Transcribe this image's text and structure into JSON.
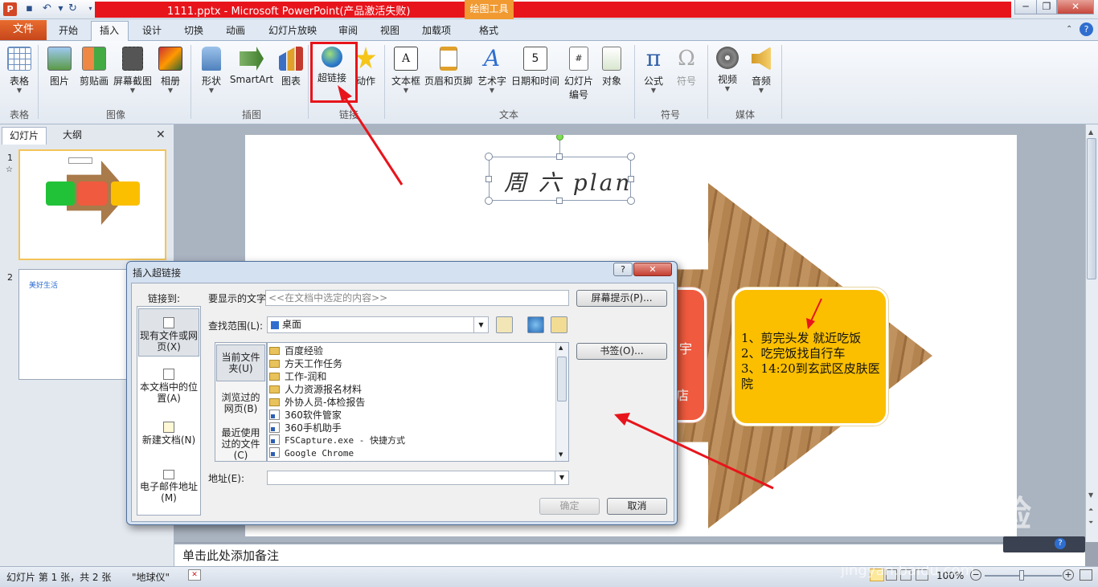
{
  "window": {
    "title": "1111.pptx - Microsoft PowerPoint(产品激活失败)",
    "tools_badge": "绘图工具"
  },
  "tabs": [
    "文件",
    "开始",
    "插入",
    "设计",
    "切换",
    "动画",
    "幻灯片放映",
    "审阅",
    "视图",
    "加载项",
    "格式"
  ],
  "ribbon": {
    "groups": {
      "table": "表格",
      "images": "图像",
      "illustrations": "插图",
      "links": "链接",
      "text": "文本",
      "symbols": "符号",
      "media": "媒体"
    },
    "buttons": {
      "table": "表格",
      "picture": "图片",
      "clipart": "剪贴画",
      "screenshot": "屏幕截图",
      "album": "相册",
      "shapes": "形状",
      "smartart": "SmartArt",
      "chart": "图表",
      "hyperlink": "超链接",
      "action": "动作",
      "textbox": "文本框",
      "header_footer": "页眉和页脚",
      "wordart": "艺术字",
      "datetime": "日期和时间",
      "slide_number_1": "幻灯片",
      "slide_number_2": "编号",
      "object": "对象",
      "equation": "公式",
      "symbol": "符号",
      "video": "视频",
      "audio": "音频"
    }
  },
  "left_pane": {
    "tab_slides": "幻灯片",
    "tab_outline": "大纲",
    "slide1_number": "1",
    "slide2_number": "2",
    "slide1_star": "☆",
    "slide2_title": "美好生活"
  },
  "slide": {
    "title_handwriting": "周 六 plan",
    "box_partial_1": "宇",
    "box_partial_2": "店",
    "yellow_lines": [
      "1、剪完头发 就近吃饭",
      "2、吃完饭找自行车",
      "3、14:20到玄武区皮肤医院"
    ]
  },
  "notes_placeholder": "单击此处添加备注",
  "status": {
    "slide_info": "幻灯片 第 1 张，共 2 张",
    "theme": "\"地球仪\"",
    "zoom": "100%"
  },
  "dialog": {
    "title": "插入超链接",
    "help": "?",
    "close": "✕",
    "link_to_label": "链接到:",
    "nav": [
      "现有文件或网页(X)",
      "本文档中的位置(A)",
      "新建文档(N)",
      "电子邮件地址(M)"
    ],
    "text_to_display_label": "要显示的文字(T):",
    "text_to_display_value": "<<在文档中选定的内容>>",
    "screentip_button": "屏幕提示(P)...",
    "look_in_label": "查找范围(L):",
    "look_in_value": "桌面",
    "sub_nav": [
      "当前文件夹(U)",
      "浏览过的网页(B)",
      "最近使用过的文件(C)"
    ],
    "bookmark_button": "书签(O)...",
    "files": [
      {
        "name": "百度经验",
        "kind": "folder"
      },
      {
        "name": "方天工作任务",
        "kind": "folder"
      },
      {
        "name": "工作-润和",
        "kind": "folder"
      },
      {
        "name": "人力资源报名材料",
        "kind": "folder"
      },
      {
        "name": "外协人员-体检报告",
        "kind": "folder"
      },
      {
        "name": "360软件管家",
        "kind": "shortcut"
      },
      {
        "name": "360手机助手",
        "kind": "shortcut"
      },
      {
        "name": "FSCapture.exe - 快捷方式",
        "kind": "shortcut"
      },
      {
        "name": "Google Chrome",
        "kind": "shortcut"
      }
    ],
    "address_label": "地址(E):",
    "ok_button": "确定",
    "cancel_button": "取消"
  },
  "watermark": {
    "brand": "Baidu经验",
    "url": "jingyan.baidu.com"
  },
  "colors": {
    "title_red": "#e8141b",
    "file_tab": "#d6551f",
    "annotation_red": "#e8141b",
    "green_box": "#22c238",
    "red_box": "#f05a3e",
    "yellow_box": "#fbbf00",
    "wood_arrow": "#a97a4a"
  }
}
